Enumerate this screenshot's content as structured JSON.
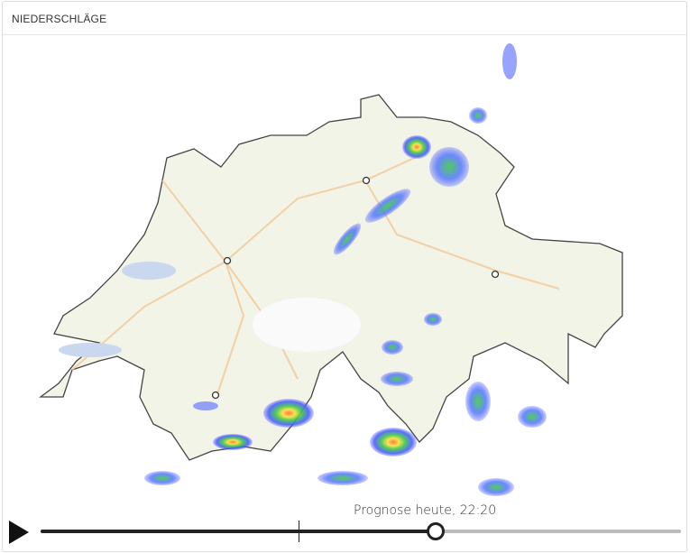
{
  "panel": {
    "title": "NIEDERSCHLÄGE"
  },
  "timeline": {
    "label": "Prognose heute, 22:20",
    "progress": 0.617,
    "now_marker": 0.403,
    "play_icon": "play-icon"
  },
  "colors": {
    "track_done": "#222222",
    "track_rest": "#bbbbbb",
    "rain_low": "#4a5cff",
    "rain_mid": "#3ec84a",
    "rain_high": "#ffe03a",
    "rain_peak": "#ff6a3a"
  }
}
